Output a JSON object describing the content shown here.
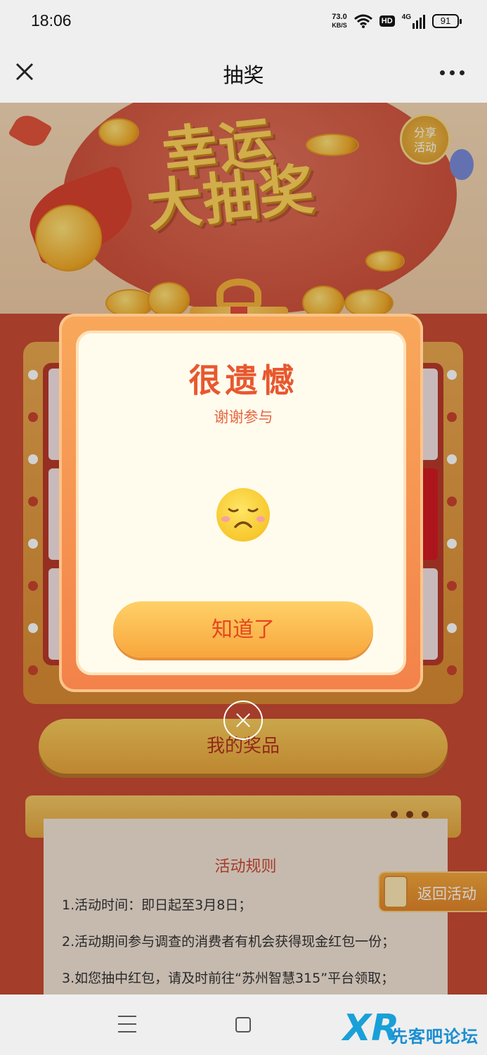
{
  "status_bar": {
    "time": "18:06",
    "net_speed_value": "73.0",
    "net_speed_unit": "KB/S",
    "hd_badge": "HD",
    "network_type": "4G",
    "battery_level": "91"
  },
  "nav": {
    "title": "抽奖"
  },
  "banner": {
    "title_line1": "幸运",
    "title_line2": "大抽奖",
    "share_label_line1": "分享",
    "share_label_line2": "活动"
  },
  "modal": {
    "title": "很遗憾",
    "subtitle": "谢谢参与",
    "confirm_label": "知道了"
  },
  "page": {
    "my_prizes_label": "我的奖品",
    "rules_title": "活动规则",
    "rules": [
      "1.活动时间：即日起至3月8日；",
      "2.活动期间参与调查的消费者有机会获得现金红包一份；",
      "3.如您抽中红包，请及时前往“苏州智慧315”平台领取；"
    ],
    "back_label": "返回活动"
  },
  "watermark": {
    "logo": "XR",
    "text": "先客吧论坛"
  },
  "colors": {
    "accent_red": "#e8582f",
    "button_orange": "#f7a63c",
    "page_red": "#c84b33",
    "watermark_blue": "#1a8ed1"
  },
  "icons": [
    "close-icon",
    "more-icon",
    "wifi-icon",
    "signal-icon",
    "battery-icon",
    "sad-face-icon",
    "menu-icon",
    "home-icon",
    "phone-icon"
  ]
}
